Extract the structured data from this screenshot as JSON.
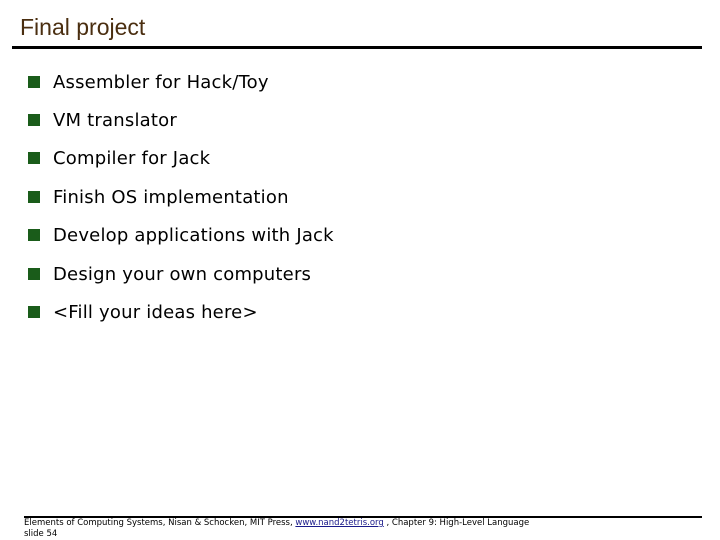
{
  "slide": {
    "title": "Final project",
    "bullets": [
      "Assembler for Hack/Toy",
      "VM translator",
      "Compiler for Jack",
      "Finish OS implementation",
      "Develop applications with Jack",
      "Design your own computers",
      "<Fill your ideas here>"
    ],
    "bullet_color": "#1a5c1a",
    "title_color": "#4a2e10"
  },
  "footer": {
    "citation_prefix": "Elements of Computing Systems, Nisan & Schocken, MIT Press, ",
    "link_text": "www.nand2tetris.org",
    "citation_suffix": " , Chapter 9: High-Level Language",
    "slide_label": "slide 54"
  }
}
